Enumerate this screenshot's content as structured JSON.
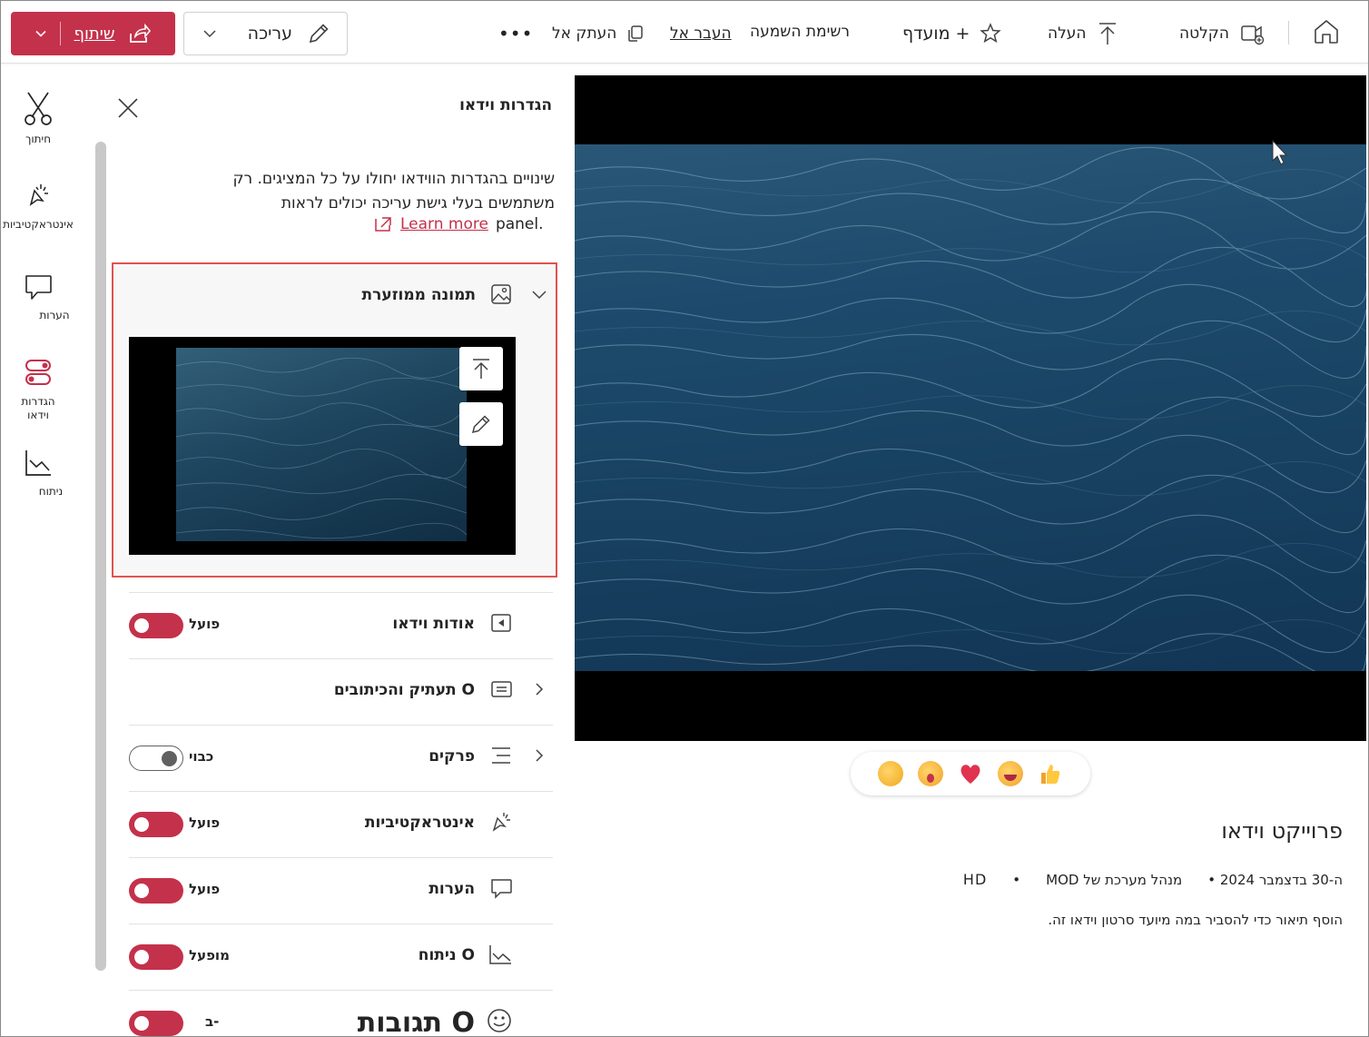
{
  "toolbar": {
    "share_label": "שיתוף",
    "edit_label": "עריכה",
    "copy_to_label": "העתק אל",
    "move_to_label": "העבר אל",
    "playlist_label": "רשימת השמעה",
    "favorite_label": "מועדף +",
    "upload_label": "העלה",
    "record_label": "הקלטה"
  },
  "rail": {
    "items": [
      {
        "label": "חיתוך",
        "icon": "scissors-icon"
      },
      {
        "label": "אינטראקטיביות",
        "icon": "interactivity-icon"
      },
      {
        "label": "הערות",
        "icon": "comments-icon"
      },
      {
        "label": "הגדרות וידאו",
        "icon": "settings-toggle-icon"
      },
      {
        "label": "ניתוח",
        "icon": "analytics-icon"
      }
    ]
  },
  "panel": {
    "title": "הגדרות וידאו",
    "notice": "שינויים בהגדרות הווידאו יחולו על כל המציגים. רק משתמשים בעלי גישת עריכה יכולים לראות",
    "notice_tail": "panel.",
    "learn_more": "Learn more",
    "thumbnail_label": "תמונה ממוזערת",
    "settings": [
      {
        "label": "אודות וידאו",
        "state": "פועל",
        "on": true,
        "icon": "video-info-icon"
      },
      {
        "label": "תעתיק והכיתובים O",
        "state": "",
        "on": null,
        "icon": "captions-icon"
      },
      {
        "label": "פרקים",
        "state": "כבוי",
        "on": false,
        "icon": "chapters-icon"
      },
      {
        "label": "אינטראקטיביות",
        "state": "פועל",
        "on": true,
        "icon": "interactivity-icon"
      },
      {
        "label": "הערות",
        "state": "פועל",
        "on": true,
        "icon": "comments-icon"
      },
      {
        "label": "ניתוח O",
        "state": "מופעל",
        "on": true,
        "icon": "analytics-icon"
      },
      {
        "label": "תגובות O",
        "state": "ב-",
        "on": true,
        "icon": "smile-icon"
      }
    ]
  },
  "video": {
    "title": "פרוייקט וידאו",
    "date": "ה-30 בדצמבר 2024 •",
    "owner": "מנהל מערכת של MOD",
    "bullet": "•",
    "quality": "HD",
    "description": "הוסף תיאור כדי להסביר במה מיועד סרטון וידאו זה."
  },
  "reactions": [
    "clap-emoji",
    "surprised-emoji",
    "heart-emoji",
    "laugh-emoji",
    "thumbs-up-emoji"
  ],
  "colors": {
    "accent": "#c4314b",
    "highlight_border": "#e05252"
  }
}
